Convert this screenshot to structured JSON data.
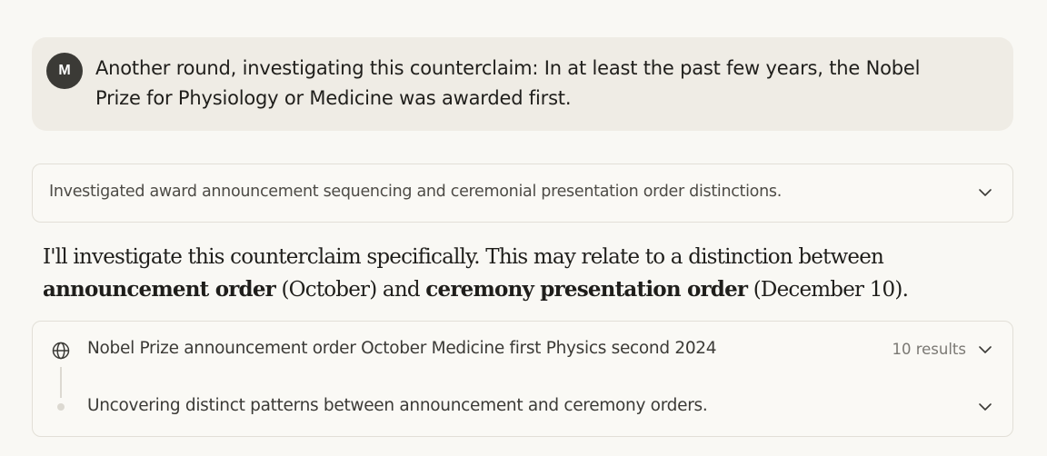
{
  "user_message": {
    "avatar_initial": "M",
    "text": "Another round, investigating this counterclaim: In at least the past few years, the Nobel Prize for Physiology or Medicine was awarded first."
  },
  "thinking_summary": {
    "text": "Investigated award announcement sequencing and ceremonial presentation order distinctions.",
    "chevron_icon": "chevron-down-icon"
  },
  "assistant_message": {
    "part1": "I'll investigate this counterclaim specifically. This may relate to a distinction between ",
    "bold1": "announcement order",
    "part2": " (October) and ",
    "bold2": "ceremony presentation order",
    "part3": " (December 10)."
  },
  "tool_use": {
    "search_icon": "globe-icon",
    "search_query": "Nobel Prize announcement order October Medicine first Physics second 2024",
    "results_count": "10 results",
    "step_text": "Uncovering distinct patterns between announcement and ceremony orders."
  },
  "colors": {
    "background": "#f9f8f4",
    "user_bubble": "#efece5",
    "avatar": "#3b3a36",
    "border": "#e2dfd7"
  }
}
